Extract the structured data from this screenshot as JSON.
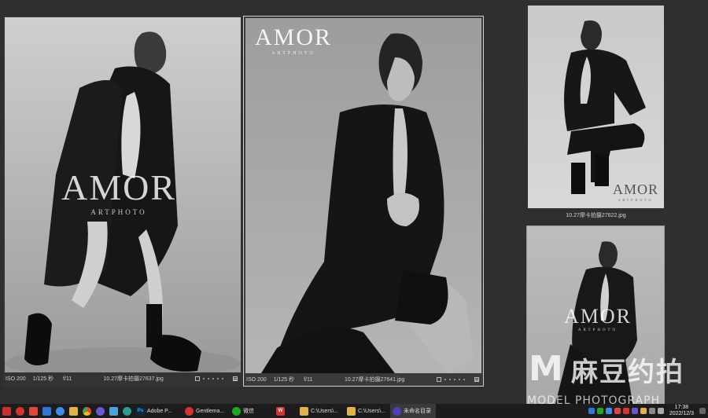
{
  "photos": [
    {
      "iso": "ISO 200",
      "shutter": "1/125 秒",
      "aperture": "f/11",
      "filename": "10.27摩卡拍摄27637.jpg",
      "watermark_title": "AMOR",
      "watermark_sub": "ARTPHOTO"
    },
    {
      "iso": "ISO 200",
      "shutter": "1/125 秒",
      "aperture": "f/11",
      "filename": "10.27摩卡拍摄27641.jpg",
      "watermark_title": "AMOR",
      "watermark_sub": "ARTPHOTO"
    },
    {
      "filename": "10.27摩卡拍摄27622.jpg",
      "watermark_title": "AMOR",
      "watermark_sub": "ARTPHOTO"
    },
    {
      "watermark_title": "AMOR",
      "watermark_sub": "ARTPHOTO"
    }
  ],
  "brand_overlay": {
    "mark": "M",
    "chinese": "麻豆约拍",
    "english": "MODEL PHOTOGRAPH"
  },
  "taskbar": {
    "apps": [
      {
        "icon": "record-icon",
        "color": "#d9342b"
      },
      {
        "icon": "browser-icon",
        "color": "#2f76d6"
      },
      {
        "icon": "cloud-icon",
        "color": "#3b8fe8"
      },
      {
        "icon": "folder-icon",
        "color": "#e3b341"
      },
      {
        "icon": "chrome-icon",
        "color": "#e94235"
      },
      {
        "icon": "app-icon",
        "color": "#6b57d6"
      },
      {
        "icon": "network-icon",
        "color": "#4aa3df"
      },
      {
        "icon": "search-app-icon",
        "color": "#2a9d8f"
      }
    ],
    "photoshop_label": "Adobe P...",
    "photoshop_icon": "Ps",
    "netease_label": "Gentlema...",
    "wechat_label": "微信",
    "wps_label": "W",
    "explorer1_label": "C:\\Users\\...",
    "explorer2_label": "C:\\Users\\...",
    "unnamed_label": "未命名目录",
    "clock_time": "17:38",
    "clock_date": "2022/12/3"
  }
}
